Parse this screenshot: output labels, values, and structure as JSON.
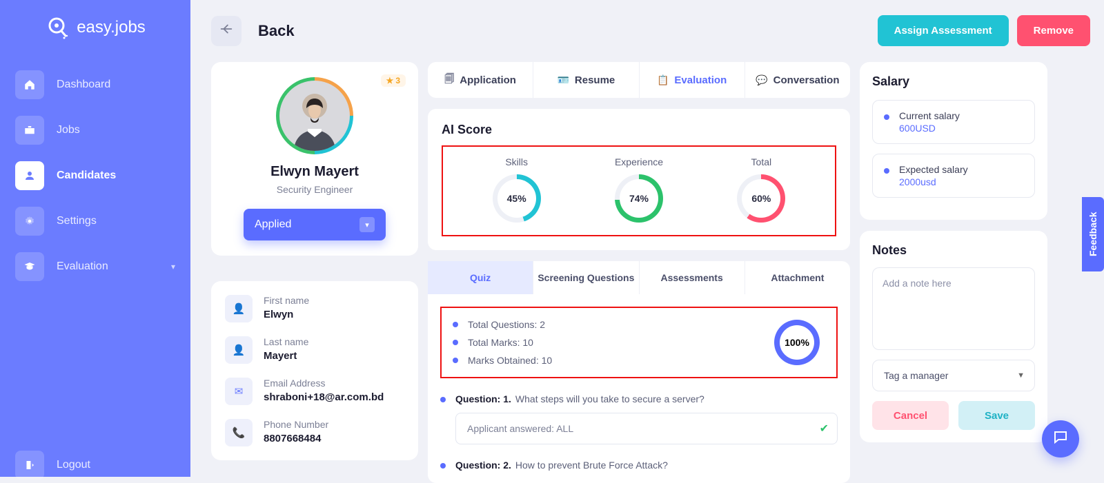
{
  "app": {
    "brand": "easy.jobs"
  },
  "sidebar": {
    "items": [
      {
        "label": "Dashboard"
      },
      {
        "label": "Jobs"
      },
      {
        "label": "Candidates"
      },
      {
        "label": "Settings"
      },
      {
        "label": "Evaluation"
      }
    ],
    "logout": "Logout"
  },
  "header": {
    "back": "Back",
    "assign": "Assign Assessment",
    "remove": "Remove"
  },
  "candidate": {
    "rating": "3",
    "name": "Elwyn Mayert",
    "role": "Security Engineer",
    "status": "Applied",
    "fields": {
      "first_name_label": "First name",
      "first_name": "Elwyn",
      "last_name_label": "Last name",
      "last_name": "Mayert",
      "email_label": "Email Address",
      "email": "shraboni+18@ar.com.bd",
      "phone_label": "Phone Number",
      "phone": "8807668484"
    }
  },
  "main": {
    "tabs": [
      "Application",
      "Resume",
      "Evaluation",
      "Conversation"
    ],
    "ai_title": "AI Score",
    "scores": {
      "skills_label": "Skills",
      "skills": "45%",
      "exp_label": "Experience",
      "exp": "74%",
      "total_label": "Total",
      "total": "60%"
    },
    "sub_tabs": [
      "Quiz",
      "Screening Questions",
      "Assessments",
      "Attachment"
    ],
    "quiz": {
      "total_q": "Total Questions: 2",
      "total_m": "Total Marks: 10",
      "marks_o": "Marks Obtained: 10",
      "score": "100%",
      "q1_label": "Question: 1.",
      "q1_text": "What steps will you take to secure a server?",
      "q1_answer": "Applicant answered: ALL",
      "q2_label": "Question: 2.",
      "q2_text": "How to prevent Brute Force Attack?"
    }
  },
  "salary": {
    "title": "Salary",
    "cur_label": "Current salary",
    "cur_val": "600USD",
    "exp_label": "Expected salary",
    "exp_val": "2000usd"
  },
  "notes": {
    "title": "Notes",
    "placeholder": "Add a note here",
    "tag": "Tag a manager",
    "cancel": "Cancel",
    "save": "Save"
  },
  "feedback": "Feedback",
  "chart_data": [
    {
      "type": "pie",
      "title": "Skills",
      "values": [
        45,
        55
      ],
      "labels": [
        "score",
        "remaining"
      ],
      "display": "45%",
      "color": "#21c3d4"
    },
    {
      "type": "pie",
      "title": "Experience",
      "values": [
        74,
        26
      ],
      "labels": [
        "score",
        "remaining"
      ],
      "display": "74%",
      "color": "#2cc26b"
    },
    {
      "type": "pie",
      "title": "Total",
      "values": [
        60,
        40
      ],
      "labels": [
        "score",
        "remaining"
      ],
      "display": "60%",
      "color": "#ff5170"
    },
    {
      "type": "pie",
      "title": "Quiz",
      "values": [
        100,
        0
      ],
      "labels": [
        "score",
        "remaining"
      ],
      "display": "100%",
      "color": "#5a6cff"
    }
  ]
}
